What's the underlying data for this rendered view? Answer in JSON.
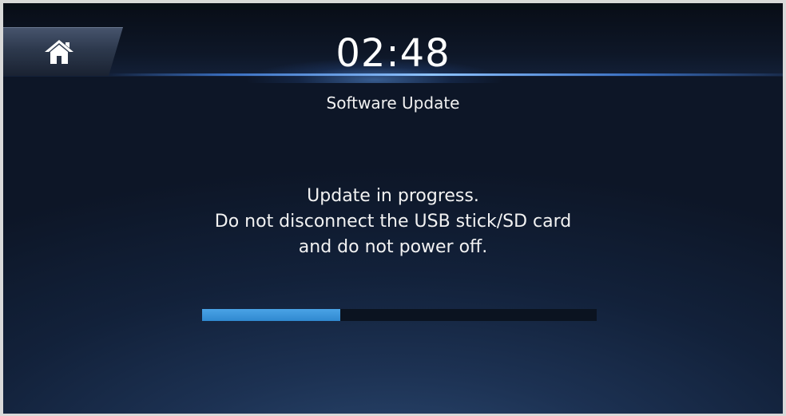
{
  "header": {
    "clock": "02:48",
    "home_icon": "home-icon"
  },
  "screen": {
    "title": "Software Update",
    "message_lines": [
      "Update in progress.",
      "Do not disconnect the USB stick/SD card",
      "and do not power off."
    ]
  },
  "progress": {
    "fraction": 0.35,
    "fill_color": "#3a96dc",
    "track_color": "#0b1320"
  },
  "colors": {
    "accent_line": "#8fc4ff",
    "background": "#12213a"
  }
}
